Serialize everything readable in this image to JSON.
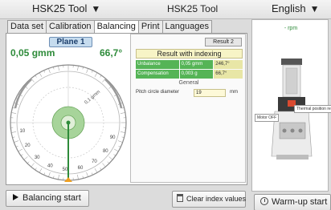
{
  "header": {
    "tool_select": "HSK25 Tool",
    "title": "HSK25 Tool",
    "language": "English"
  },
  "tabs": [
    {
      "label": "Data set"
    },
    {
      "label": "Calibration"
    },
    {
      "label": "Balancing",
      "active": true
    },
    {
      "label": "Print"
    },
    {
      "label": "Languages"
    }
  ],
  "plane": {
    "label": "Plane 1",
    "unbalance": "0,05 gmm",
    "angle": "66,7°",
    "dial_label": "0,1 gmm"
  },
  "dial_ticks": [
    "10",
    "20",
    "30",
    "40",
    "50",
    "60",
    "70",
    "80",
    "90"
  ],
  "results": {
    "tab_label": "Result 2",
    "header": "Result with indexing",
    "rows": [
      {
        "label": "Unbalance",
        "value": "0,05 gmm",
        "angle": "246,7°"
      },
      {
        "label": "Compensation",
        "value": "0,003 g",
        "angle": "66,7°"
      }
    ],
    "general_label": "General",
    "pitch_label": "Pitch circle diameter",
    "pitch_value": "19",
    "pitch_unit": "mm"
  },
  "machine": {
    "rpm": "- rpm",
    "motor_off": "Motor OFF",
    "thermal": "Thermal position reached"
  },
  "buttons": {
    "balancing_start": "Balancing start",
    "clear_index": "Clear index values",
    "warmup_start": "Warm-up start"
  },
  "colors": {
    "accent_green": "#2e8b3a",
    "result_green": "#55b456",
    "highlight_yellow": "#f7f4c6",
    "plane_blue": "#c6dcef"
  }
}
